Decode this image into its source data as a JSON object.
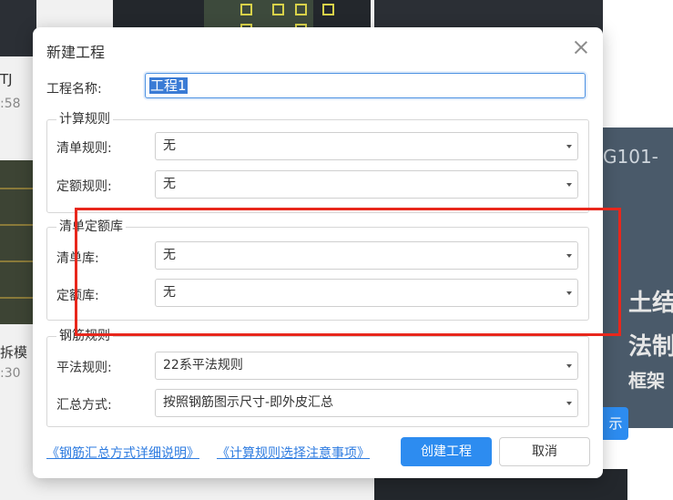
{
  "background": {
    "card1_title": "TJ",
    "card1_time": ":58",
    "card2_title": "拆模",
    "card2_time": ":30",
    "right_text_1": "G101-",
    "right_text_2": "土结构",
    "right_text_3": "法制",
    "right_text_4": "框架",
    "right_button": "示"
  },
  "dialog": {
    "title": "新建工程",
    "name_label": "工程名称:",
    "name_value": "工程1",
    "calc_rules": {
      "legend": "计算规则",
      "bill_rule_label": "清单规则:",
      "bill_rule_value": "无",
      "quota_rule_label": "定额规则:",
      "quota_rule_value": "无"
    },
    "library": {
      "legend": "清单定额库",
      "bill_lib_label": "清单库:",
      "bill_lib_value": "无",
      "quota_lib_label": "定额库:",
      "quota_lib_value": "无"
    },
    "rebar_rules": {
      "legend": "钢筋规则",
      "pingfa_label": "平法规则:",
      "pingfa_value": "22系平法规则",
      "summary_label": "汇总方式:",
      "summary_value": "按照钢筋图示尺寸-即外皮汇总"
    },
    "link_summary_help": "《钢筋汇总方式详细说明》",
    "link_calc_notes": "《计算规则选择注意事项》",
    "create_button": "创建工程",
    "cancel_button": "取消"
  },
  "colors": {
    "primary": "#2d8cf0",
    "link": "#2d7be0",
    "highlight": "#e8271c"
  }
}
